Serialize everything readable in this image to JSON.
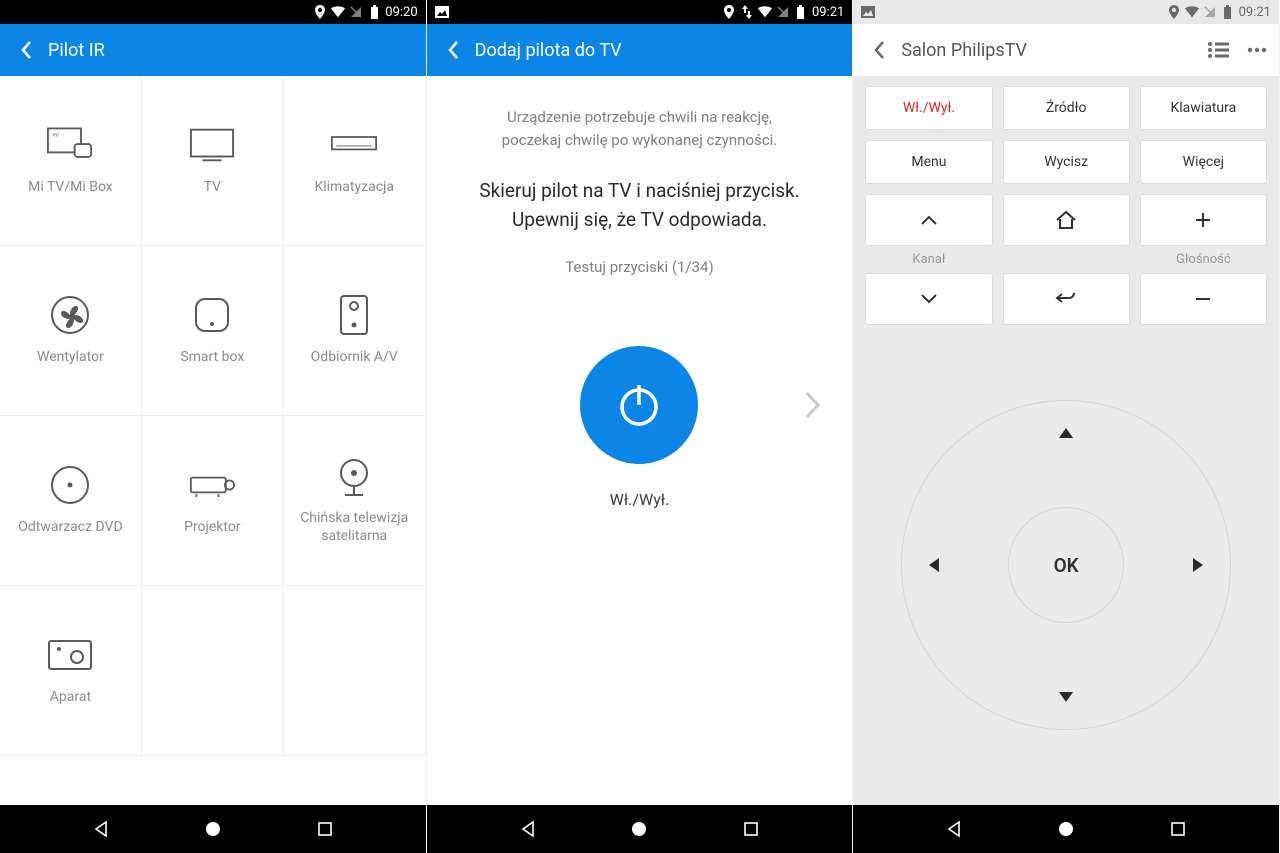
{
  "statusbar": {
    "s1": {
      "time": "09:20"
    },
    "s2": {
      "time": "09:21"
    },
    "s3": {
      "time": "09:21"
    }
  },
  "screen1": {
    "title": "Pilot IR",
    "items": [
      {
        "label": "Mi TV/Mi Box"
      },
      {
        "label": "TV"
      },
      {
        "label": "Klimatyzacja"
      },
      {
        "label": "Wentylator"
      },
      {
        "label": "Smart box"
      },
      {
        "label": "Odbiornik A/V"
      },
      {
        "label": "Odtwarzacz DVD"
      },
      {
        "label": "Projektor"
      },
      {
        "label": "Chińska telewizja satelitarna"
      },
      {
        "label": "Aparat"
      }
    ]
  },
  "screen2": {
    "title": "Dodaj pilota do TV",
    "hint_line1": "Urządzenie potrzebuje chwili na reakcję,",
    "hint_line2": "poczekaj chwilę po wykonanej czynności.",
    "main_line1": "Skieruj pilot na TV i naciśniej przycisk.",
    "main_line2": "Upewnij się, że TV odpowiada.",
    "test_label": "Testuj przyciski (1/34)",
    "power_label": "Wł./Wył."
  },
  "screen3": {
    "title": "Salon PhilipsTV",
    "row1": {
      "power": "Wł./Wył.",
      "source": "Źródło",
      "keyboard": "Klawiatura"
    },
    "row2": {
      "menu": "Menu",
      "mute": "Wycisz",
      "more": "Więcej"
    },
    "labels": {
      "channel": "Kanał",
      "volume": "Głośność"
    },
    "ok": "OK"
  }
}
